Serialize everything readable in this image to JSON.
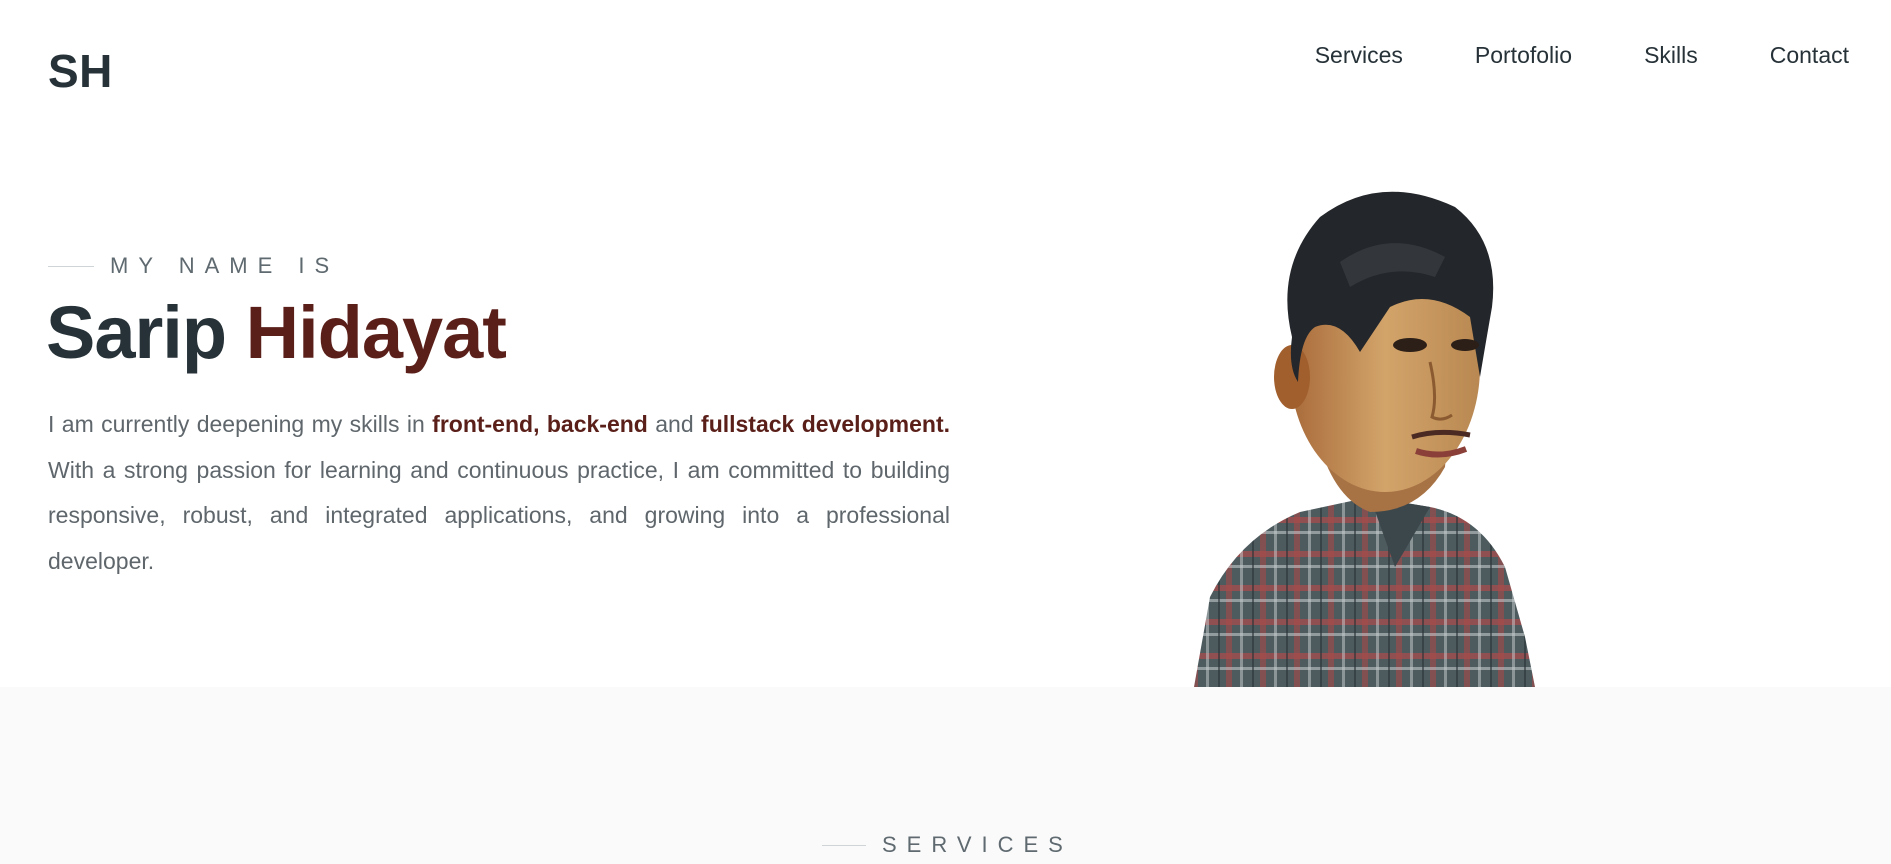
{
  "brand": {
    "logo": "SH"
  },
  "nav": {
    "items": [
      {
        "label": "Services"
      },
      {
        "label": "Portofolio"
      },
      {
        "label": "Skills"
      },
      {
        "label": "Contact"
      }
    ]
  },
  "hero": {
    "eyebrow": "MY NAME IS",
    "first_name": "Sarip",
    "last_name": "Hidayat",
    "bio": {
      "p1": "I am currently deepening my skills in ",
      "hl1": "front-end,",
      "p2": " ",
      "hl2": "back-end",
      "p3": " and ",
      "hl3": "fullstack development.",
      "p4": " With a strong passion for learning and continuous practice, I am committed to building responsive, robust, and integrated applications, and growing into a professional developer."
    }
  },
  "services": {
    "eyebrow": "SERVICES"
  },
  "colors": {
    "primary_text": "#263238",
    "accent": "#5a1f19",
    "muted_text": "#5f676c",
    "section_bg": "#fafafa"
  }
}
